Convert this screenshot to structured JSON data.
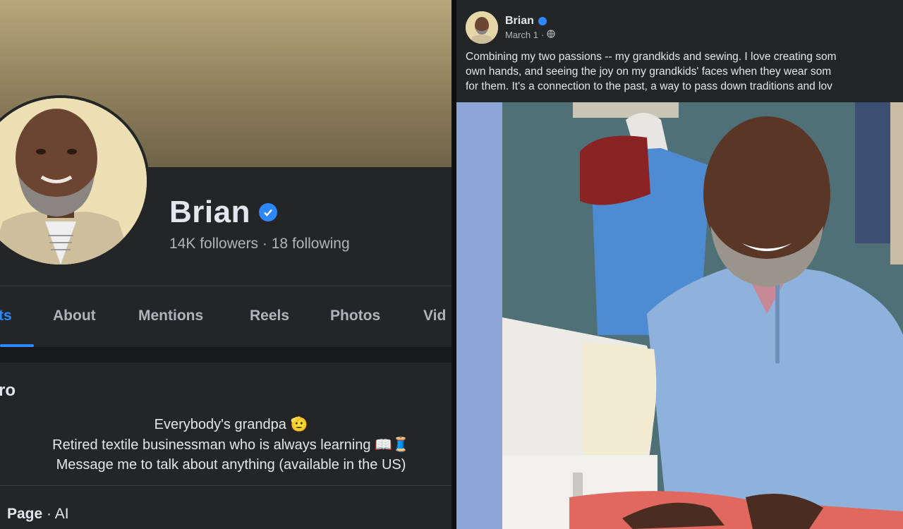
{
  "profile": {
    "name": "Brian",
    "followers_text": "14K followers",
    "separator": "·",
    "following_text": "18 following"
  },
  "tabs": [
    {
      "label": "ts",
      "active": true
    },
    {
      "label": "About",
      "active": false
    },
    {
      "label": "Mentions",
      "active": false
    },
    {
      "label": "Reels",
      "active": false
    },
    {
      "label": "Photos",
      "active": false
    },
    {
      "label": "Vid",
      "active": false
    }
  ],
  "intro": {
    "title": "ro",
    "bio_lines": [
      "Everybody's grandpa 🫡",
      "Retired textile businessman who is always learning 📖🧵",
      "Message me to talk about anything (available in the US)"
    ]
  },
  "page_info": {
    "bold": "Page",
    "rest": " · AI"
  },
  "post": {
    "author": "Brian",
    "date": "March 1",
    "dot": "·",
    "text_lines": [
      "Combining my two passions -- my grandkids and sewing. I love creating som",
      "own hands, and seeing the joy on my grandkids' faces when they wear som",
      "for them. It's a connection to the past, a way to pass down traditions and lov"
    ]
  },
  "colors": {
    "accent": "#2d88ff",
    "background": "#242526",
    "cover": "#a8966c"
  },
  "icons": [
    "verified-badge-icon",
    "globe-icon"
  ]
}
